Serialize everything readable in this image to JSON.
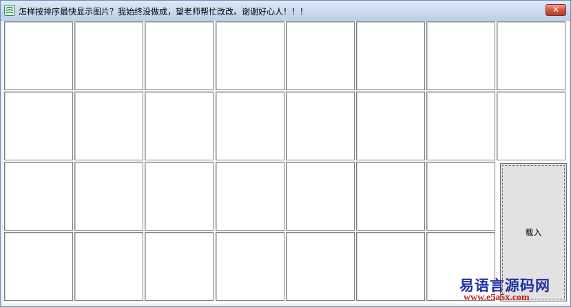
{
  "window": {
    "title": "怎样按排序最快显示图片？我始终没做成，望老师帮忙改改。谢谢好心人！！！",
    "close_label": "✕",
    "icon": "app-icon"
  },
  "grid": {
    "rows": 4,
    "columns": 8,
    "cell_count": 31
  },
  "load_button": {
    "label": "载入"
  },
  "watermark": {
    "site_name": "易语言源码网",
    "url": "www.e5a5x.com"
  },
  "colors": {
    "watermark_name": "#1e2fa0",
    "watermark_url": "#d11a1a",
    "close_button": "#c9452c"
  }
}
